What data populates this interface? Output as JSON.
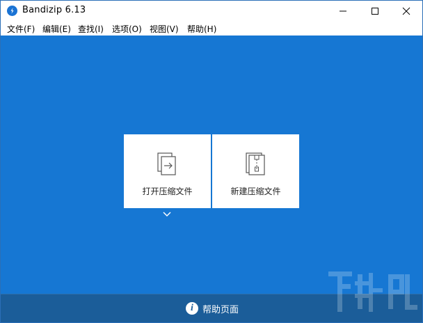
{
  "window": {
    "title": "Bandizip 6.13",
    "app_icon": "bandizip-logo-icon",
    "controls": [
      "minimize-icon",
      "maximize-icon",
      "close-icon"
    ]
  },
  "menu": {
    "items": [
      {
        "label": "文件(F)"
      },
      {
        "label": "编辑(E)"
      },
      {
        "label": "查找(I)"
      },
      {
        "label": "选项(O)"
      },
      {
        "label": "视图(V)"
      },
      {
        "label": "帮助(H)"
      }
    ]
  },
  "main": {
    "background": "#1677d3",
    "tiles": [
      {
        "label": "打开压缩文件",
        "icon": "open-archive-icon"
      },
      {
        "label": "新建压缩文件",
        "icon": "new-archive-icon"
      }
    ],
    "expand_icon": "chevron-down-icon"
  },
  "footer": {
    "label": "帮助页面",
    "icon": "info-icon",
    "background": "#1b5d99"
  }
}
